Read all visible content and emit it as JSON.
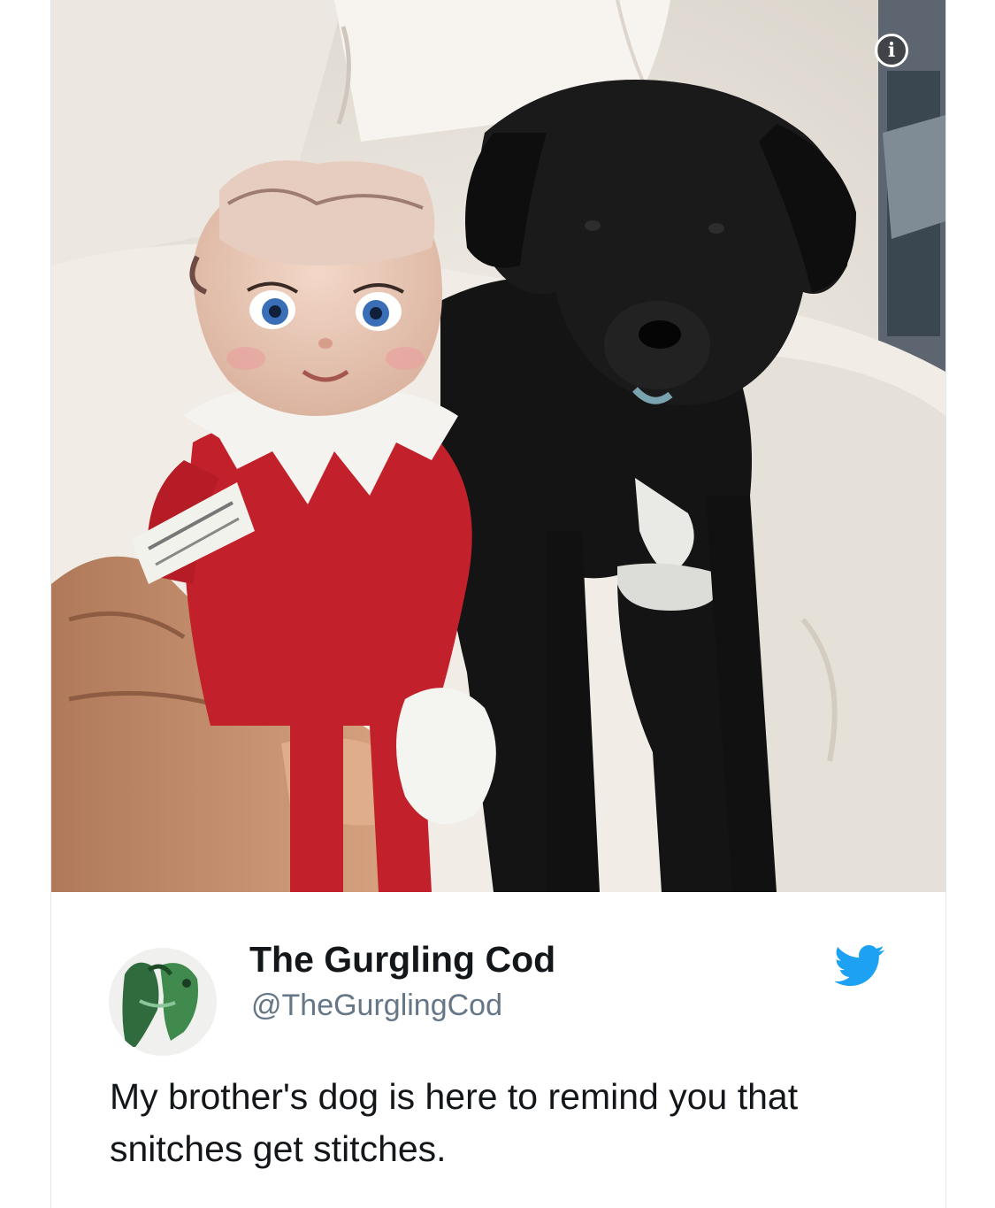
{
  "tweet": {
    "display_name": "The Gurgling Cod",
    "handle": "@TheGurglingCod",
    "text": "My brother's dog is here to remind you that snitches get stitches.",
    "brand_color": "#1da1f2",
    "media": {
      "description_icon": "info-icon",
      "info_glyph": "i"
    },
    "icons": {
      "platform": "twitter-bird-icon",
      "avatar": "avatar-image"
    }
  }
}
